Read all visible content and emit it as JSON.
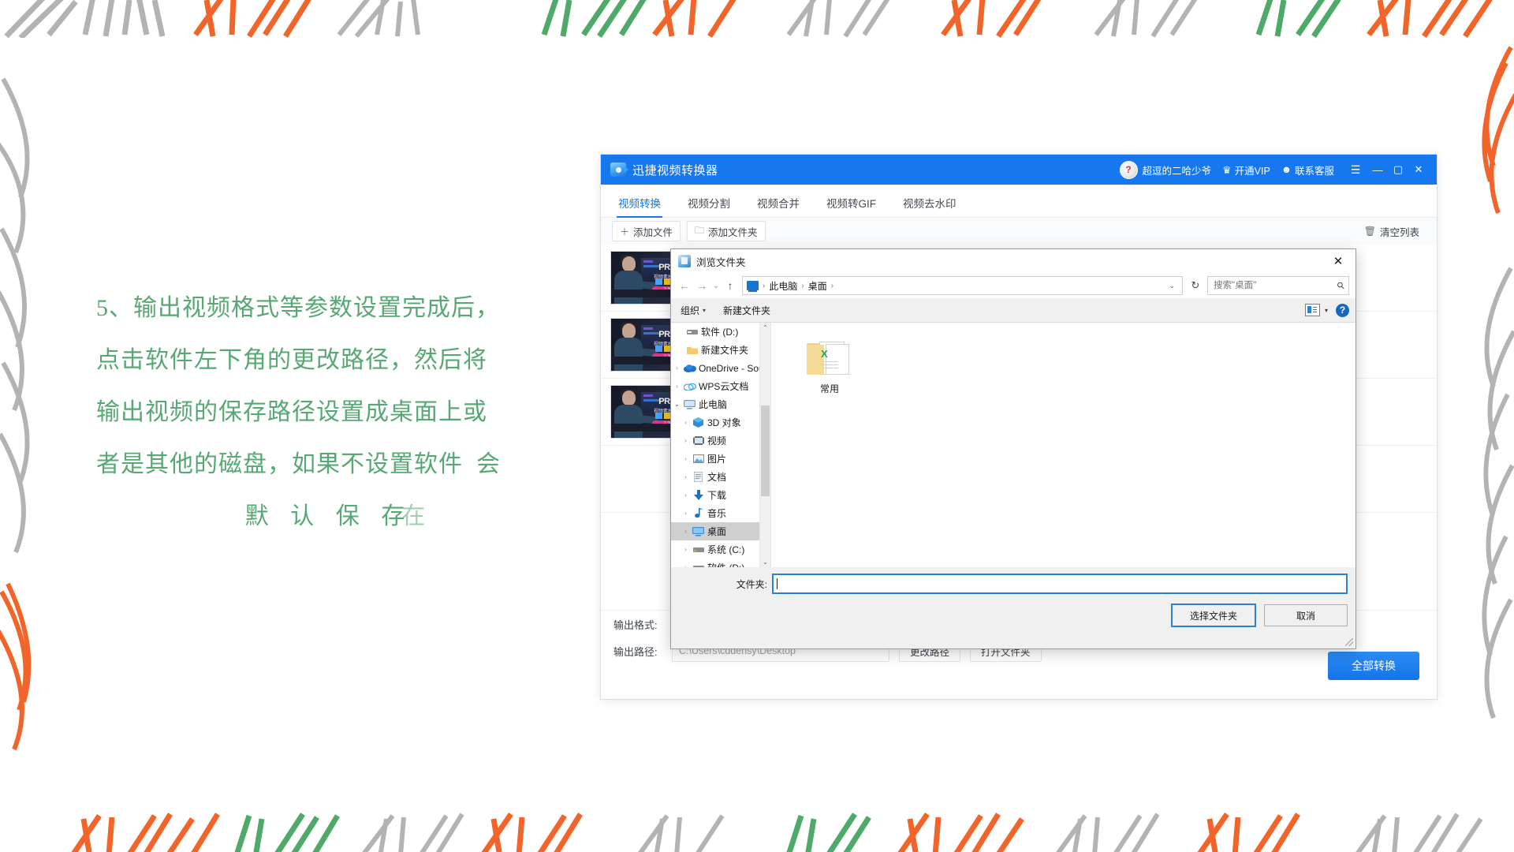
{
  "instruction": {
    "lines": [
      "5、输出视频格式等参数设置完成后，",
      "点击软件左下角的更改路径，然后将",
      "输出视频的保存路径设置成桌面上或",
      "者是其他的磁盘，如果不设置软件  会"
    ],
    "last_line": "默 认 保 存",
    "ghost": "在",
    "color": "#57a873"
  },
  "app": {
    "title": "迅捷视频转换器",
    "accent": "#1677ef",
    "titlebar": {
      "user_name": "超逗的二哈少爷",
      "vip_label": "开通VIP",
      "support_label": "联系客服",
      "avatar_glyph": "?",
      "crown_icon": "crown-icon",
      "chat_icon": "chat-icon",
      "menu_icon": "hamburger-menu-icon",
      "minimize_icon": "—",
      "maximize_icon": "▢",
      "close_icon": "✕"
    },
    "tabs": [
      {
        "label": "视频转换",
        "active": true
      },
      {
        "label": "视频分割",
        "active": false
      },
      {
        "label": "视频合并",
        "active": false
      },
      {
        "label": "视频转GIF",
        "active": false
      },
      {
        "label": "视频去水印",
        "active": false
      }
    ],
    "toolbar": {
      "add_file": "添加文件",
      "add_file_icon": "＋",
      "add_folder": "添加文件夹",
      "add_folder_icon": "🗀",
      "clear_list": "清空列表",
      "clear_list_icon": "🗑"
    },
    "file_rows": [
      {
        "title": "PRA",
        "sub": "视频素材",
        "badge": "1:30"
      },
      {
        "title": "PRA",
        "sub": "视频素材",
        "badge": "1:30"
      },
      {
        "title": "PRA",
        "sub": "视频素材",
        "badge": "1:30"
      }
    ],
    "bottom": {
      "format_label": "输出格式:",
      "format_value": "",
      "path_label": "输出路径:",
      "path_value": "C:\\Users\\cddehsy\\Desktop",
      "change_path": "更改路径",
      "open_folder": "打开文件夹",
      "convert_all": "全部转换"
    }
  },
  "dialog": {
    "title": "浏览文件夹",
    "close_icon": "✕",
    "nav": {
      "back_icon": "←",
      "forward_icon": "→",
      "recent_icon": "⌄",
      "up_icon": "↑",
      "breadcrumbs": [
        "此电脑",
        "桌面"
      ],
      "separator": "›",
      "dropdown_icon": "⌄",
      "refresh_icon": "↻",
      "search_placeholder": "搜索\"桌面\"",
      "search_value": "",
      "search_icon": "search-icon"
    },
    "tools": {
      "organize": "组织",
      "new_folder": "新建文件夹",
      "caret": "▾",
      "view_icon": "view-options-icon",
      "help_icon": "?"
    },
    "tree": [
      {
        "label": "软件 (D:)",
        "icon": "drive-icon",
        "indent": 1,
        "chevron": "",
        "selected": false
      },
      {
        "label": "新建文件夹",
        "icon": "folder-icon",
        "indent": 1,
        "chevron": "",
        "selected": false
      },
      {
        "label": "OneDrive - Sout",
        "icon": "onedrive-icon",
        "indent": 0,
        "chevron": "›",
        "selected": false
      },
      {
        "label": "WPS云文档",
        "icon": "wps-cloud-icon",
        "indent": 0,
        "chevron": "›",
        "selected": false
      },
      {
        "label": "此电脑",
        "icon": "this-pc-icon",
        "indent": 0,
        "chevron": "⌄",
        "selected": false
      },
      {
        "label": "3D 对象",
        "icon": "3d-objects-icon",
        "indent": 1,
        "chevron": "›",
        "selected": false
      },
      {
        "label": "视频",
        "icon": "videos-icon",
        "indent": 1,
        "chevron": "›",
        "selected": false
      },
      {
        "label": "图片",
        "icon": "pictures-icon",
        "indent": 1,
        "chevron": "›",
        "selected": false
      },
      {
        "label": "文档",
        "icon": "documents-icon",
        "indent": 1,
        "chevron": "›",
        "selected": false
      },
      {
        "label": "下载",
        "icon": "downloads-icon",
        "indent": 1,
        "chevron": "›",
        "selected": false
      },
      {
        "label": "音乐",
        "icon": "music-icon",
        "indent": 1,
        "chevron": "›",
        "selected": false
      },
      {
        "label": "桌面",
        "icon": "desktop-icon",
        "indent": 1,
        "chevron": "›",
        "selected": true
      },
      {
        "label": "系统 (C:)",
        "icon": "drive-icon",
        "indent": 1,
        "chevron": "›",
        "selected": false
      },
      {
        "label": "软件 (D:)",
        "icon": "drive-icon",
        "indent": 1,
        "chevron": "›",
        "selected": false
      }
    ],
    "files": [
      {
        "name": "常用",
        "icon": "folder-with-documents-icon"
      }
    ],
    "footer": {
      "folder_label": "文件夹:",
      "folder_value": "",
      "select_button": "选择文件夹",
      "cancel_button": "取消"
    }
  },
  "decoration": {
    "colors": {
      "gray": "#b3b3b3",
      "orange": "#f2652a",
      "green": "#4fa968"
    }
  }
}
